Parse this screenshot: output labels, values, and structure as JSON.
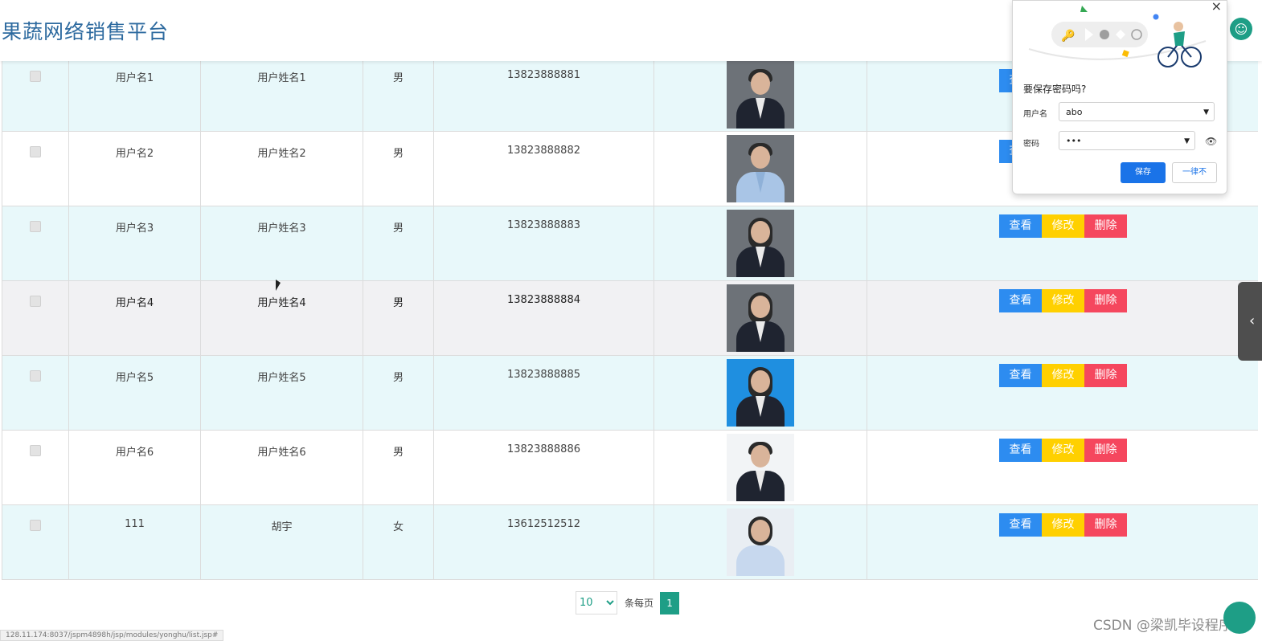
{
  "brand": "果蔬网络销售平台",
  "table": {
    "rows": [
      {
        "username": "用户名1",
        "name": "用户姓名1",
        "sex": "男",
        "phone": "13823888881",
        "photo": "man-suit"
      },
      {
        "username": "用户名2",
        "name": "用户姓名2",
        "sex": "男",
        "phone": "13823888882",
        "photo": "man-blue-shirt"
      },
      {
        "username": "用户名3",
        "name": "用户姓名3",
        "sex": "男",
        "phone": "13823888883",
        "photo": "woman-suit"
      },
      {
        "username": "用户名4",
        "name": "用户姓名4",
        "sex": "男",
        "phone": "13823888884",
        "photo": "woman-suit"
      },
      {
        "username": "用户名5",
        "name": "用户姓名5",
        "sex": "男",
        "phone": "13823888885",
        "photo": "woman-blue-bg"
      },
      {
        "username": "用户名6",
        "name": "用户姓名6",
        "sex": "男",
        "phone": "13823888886",
        "photo": "man-white-bg"
      },
      {
        "username": "111",
        "name": "胡宇",
        "sex": "女",
        "phone": "13612512512",
        "photo": "woman-light-bg"
      }
    ],
    "actions": {
      "view": "查看",
      "edit": "修改",
      "delete": "删除"
    },
    "colors": {
      "view": "#2d8cf0",
      "edit": "#ffd000",
      "delete": "#f5475e"
    }
  },
  "pagination": {
    "page_size": "10",
    "per_page_label": "条每页",
    "current_page": "1"
  },
  "status_url": "128.11.174:8037/jspm4898h/jsp/modules/yonghu/list.jsp#",
  "watermark": "CSDN @梁凯毕设程序",
  "password_popup": {
    "question": "要保存密码吗?",
    "username_label": "用户名",
    "username_value": "abo",
    "password_label": "密码",
    "password_value": "•••",
    "save_label": "保存",
    "never_label": "一律不"
  },
  "icons": {
    "close": "close-icon",
    "eye": "eye-icon",
    "avatar": "user-avatar-icon",
    "side": "chevron-left-icon"
  }
}
